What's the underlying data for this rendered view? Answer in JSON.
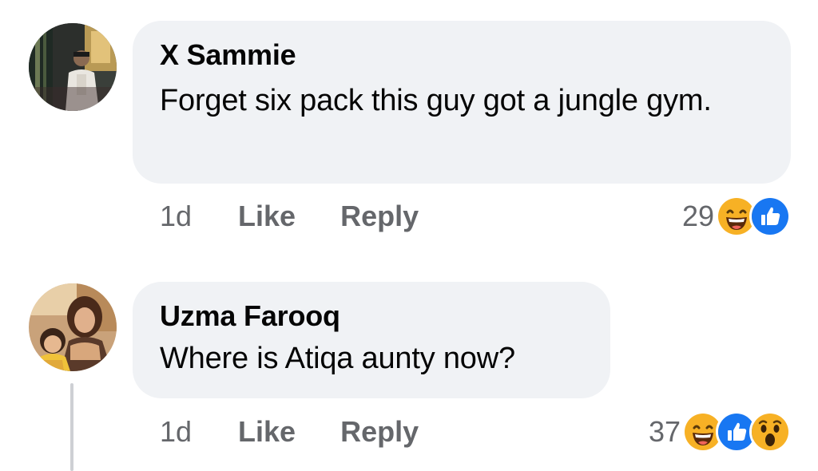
{
  "comments": [
    {
      "author": "X Sammie",
      "text": "Forget six pack  this guy got a jungle gym.",
      "time": "1d",
      "like_label": "Like",
      "reply_label": "Reply",
      "reaction_count": "29",
      "reactions": [
        "haha-icon",
        "like-icon"
      ]
    },
    {
      "author": "Uzma Farooq",
      "text": "Where is Atiqa aunty now?",
      "time": "1d",
      "like_label": "Like",
      "reply_label": "Reply",
      "reaction_count": "37",
      "reactions": [
        "haha-icon",
        "like-icon",
        "wow-icon"
      ]
    }
  ],
  "colors": {
    "bubble_bg": "#f0f2f5",
    "meta_text": "#65676b",
    "like_blue": "#1877f2",
    "reaction_yellow": "#f7b125"
  }
}
